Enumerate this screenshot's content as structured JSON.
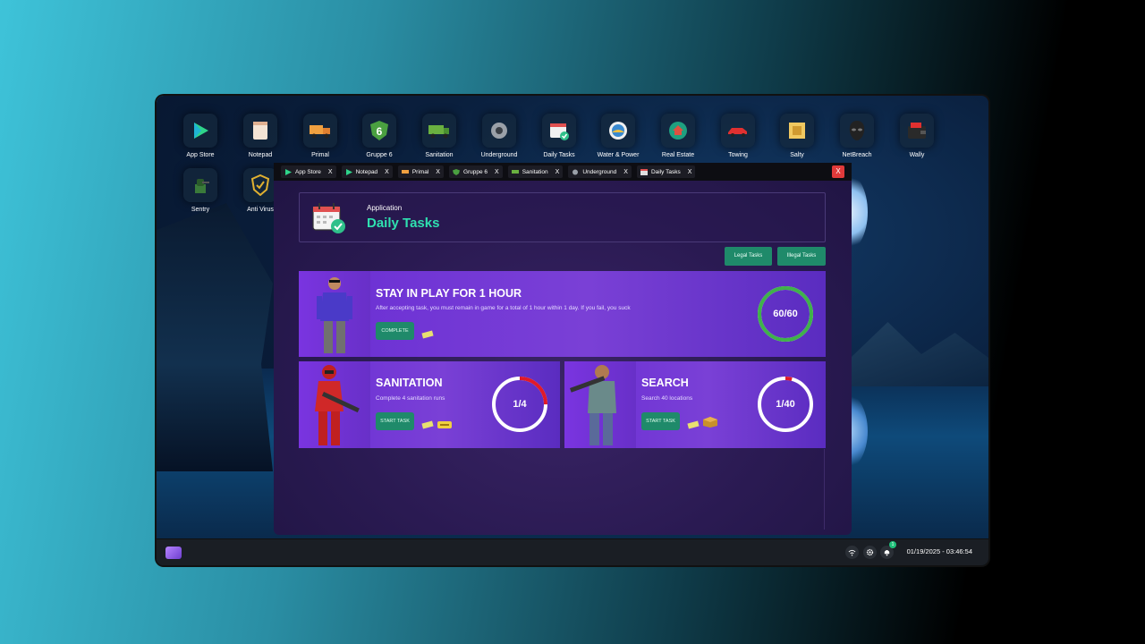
{
  "desktop": {
    "icons_row1": [
      {
        "label": "App Store",
        "icon": "play-store-icon"
      },
      {
        "label": "Notepad",
        "icon": "notepad-icon"
      },
      {
        "label": "Primal",
        "icon": "truck-icon"
      },
      {
        "label": "Gruppe 6",
        "icon": "shield-6-icon"
      },
      {
        "label": "Sanitation",
        "icon": "garbage-truck-icon"
      },
      {
        "label": "Underground",
        "icon": "turbo-icon"
      },
      {
        "label": "Daily Tasks",
        "icon": "calendar-check-icon"
      },
      {
        "label": "Water & Power",
        "icon": "water-power-icon"
      },
      {
        "label": "Real Estate",
        "icon": "house-icon"
      },
      {
        "label": "Towing",
        "icon": "tow-truck-icon"
      },
      {
        "label": "Salty",
        "icon": "salty-icon"
      },
      {
        "label": "NetBreach",
        "icon": "mask-icon"
      },
      {
        "label": "Wally",
        "icon": "wallet-icon"
      }
    ],
    "icons_row2": [
      {
        "label": "Sentry",
        "icon": "sentry-icon"
      },
      {
        "label": "Anti Virus",
        "icon": "antivirus-shield-icon"
      }
    ]
  },
  "window": {
    "tabs": [
      {
        "label": "App Store",
        "close": "X"
      },
      {
        "label": "Notepad",
        "close": "X"
      },
      {
        "label": "Primal",
        "close": "X"
      },
      {
        "label": "Gruppe 6",
        "close": "X"
      },
      {
        "label": "Sanitation",
        "close": "X"
      },
      {
        "label": "Underground",
        "close": "X"
      },
      {
        "label": "Daily Tasks",
        "close": "X"
      }
    ],
    "close_label": "X",
    "header": {
      "subtitle": "Application",
      "title": "Daily Tasks"
    },
    "filters": {
      "legal": "Legal Tasks",
      "illegal": "Illegal Tasks"
    },
    "tasks": [
      {
        "title": "STAY IN PLAY FOR 1 HOUR",
        "description": "After accepting task, you must remain in game for a total of 1 hour within 1 day. If you fail, you suck",
        "button": "COMPLETE",
        "progress_text": "60/60",
        "progress": 1.0,
        "ring_color": "#3fb14a"
      },
      {
        "title": "SANITATION",
        "description": "Complete 4 sanitation runs",
        "button": "START TASK",
        "progress_text": "1/4",
        "progress": 0.25,
        "ring_color": "#e01a2a"
      },
      {
        "title": "SEARCH",
        "description": "Search 40 locations",
        "button": "START TASK",
        "progress_text": "1/40",
        "progress": 0.025,
        "ring_color": "#e01a2a"
      }
    ]
  },
  "taskbar": {
    "notification_count": "1",
    "clock": "01/19/2025 - 03:46:54"
  },
  "colors": {
    "accent": "#2fe0b0",
    "button_green": "#1f8a6a",
    "card_purple": "#6a2ed4"
  }
}
